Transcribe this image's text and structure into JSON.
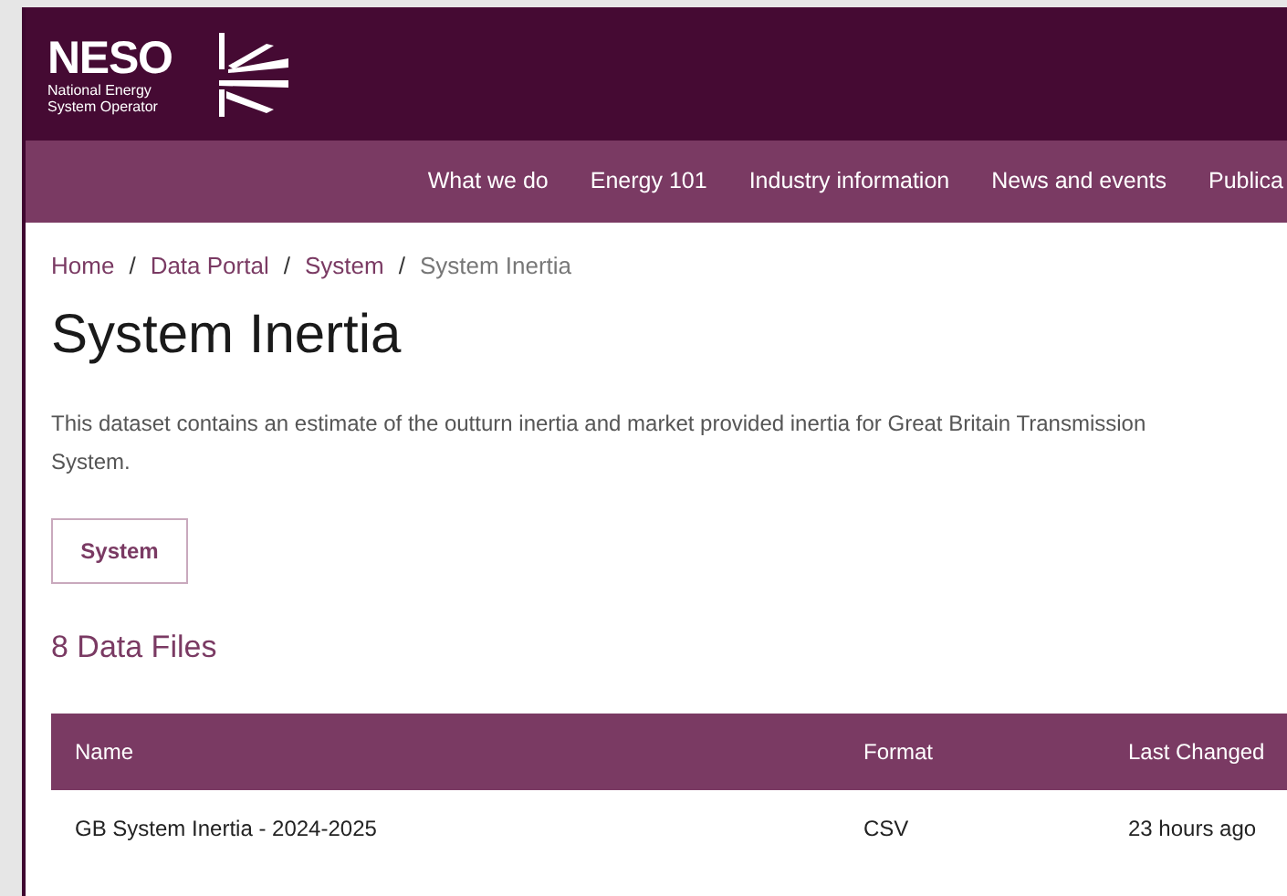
{
  "logo": {
    "wordmark": "NESO",
    "tagline": "National Energy System Operator"
  },
  "nav": [
    "What we do",
    "Energy 101",
    "Industry information",
    "News and events",
    "Publica"
  ],
  "breadcrumb": [
    {
      "label": "Home",
      "current": false
    },
    {
      "label": "Data Portal",
      "current": false
    },
    {
      "label": "System",
      "current": false
    },
    {
      "label": "System Inertia",
      "current": true
    }
  ],
  "separator": "/",
  "title": "System Inertia",
  "description": "This dataset contains an estimate of the outturn inertia and market provided inertia for Great Britain Transmission System.",
  "tag_button": "System",
  "files_heading": "8 Data Files",
  "table": {
    "columns": [
      "Name",
      "Format",
      "Last Changed"
    ],
    "rows": [
      [
        "GB System Inertia - 2024-2025",
        "CSV",
        "23 hours ago"
      ]
    ]
  }
}
